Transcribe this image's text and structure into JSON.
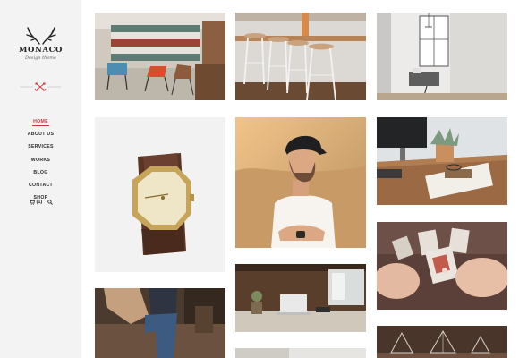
{
  "brand": {
    "title": "MONACO",
    "subtitle": "Design theme"
  },
  "nav": {
    "items": [
      {
        "label": "HOME",
        "active": true
      },
      {
        "label": "ABOUT US",
        "active": false
      },
      {
        "label": "SERVICES",
        "active": false
      },
      {
        "label": "WORKS",
        "active": false
      },
      {
        "label": "BLOG",
        "active": false
      },
      {
        "label": "CONTACT",
        "active": false
      },
      {
        "label": "SHOP",
        "active": false
      }
    ],
    "cart_count": "(1)"
  },
  "colors": {
    "accent": "#c7373d",
    "sidebar_bg": "#f3f3f3"
  },
  "icons": {
    "logo": "antlers-logo-icon",
    "divider": "crossed-arrows-icon",
    "cart": "cart-icon",
    "search": "search-icon"
  },
  "gallery": {
    "tiles": [
      {
        "subject": "colorful-chairs-on-patio"
      },
      {
        "subject": "bar-stools-interior"
      },
      {
        "subject": "living-room-window"
      },
      {
        "subject": "gold-wristwatch"
      },
      {
        "subject": "man-in-cap-portrait"
      },
      {
        "subject": "desk-with-monitor-and-plant"
      },
      {
        "subject": "hands-holding-card"
      },
      {
        "subject": "laptop-on-wooden-desk"
      },
      {
        "subject": "person-sitting-jeans"
      },
      {
        "subject": "decor-shelf"
      }
    ]
  }
}
